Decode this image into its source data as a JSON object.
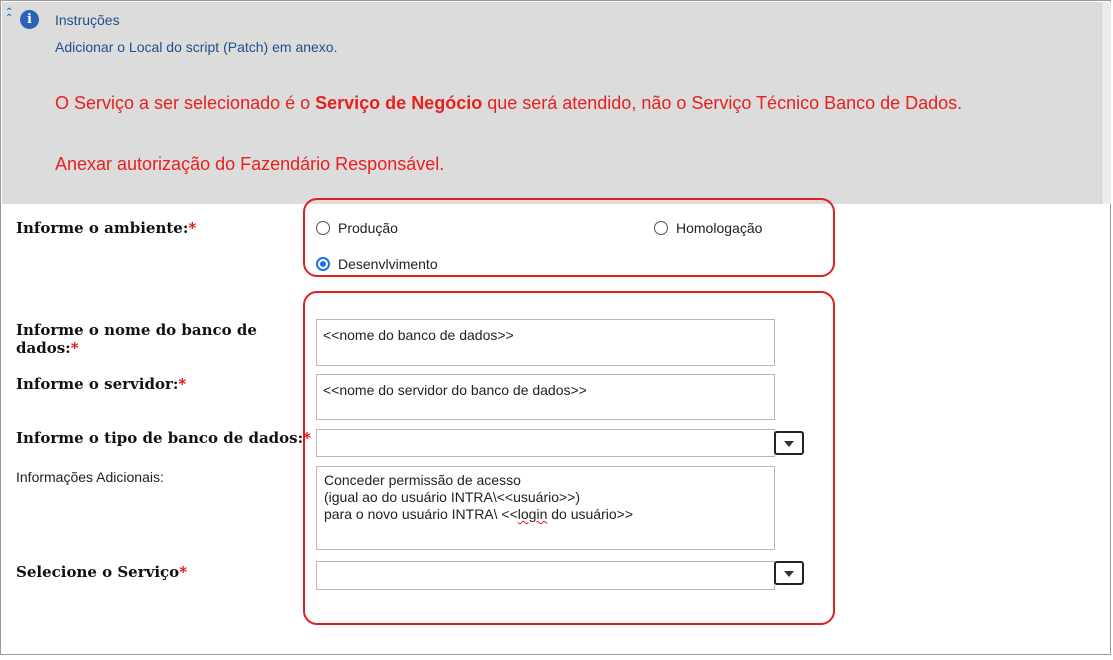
{
  "instructions": {
    "title": "Instruções",
    "line1": "Adicionar o Local do script (Patch) em anexo.",
    "red1_pre": "O Serviço a ser selecionado é o ",
    "red1_bold": "Serviço de Negócio",
    "red1_post": " que será atendido, não o Serviço Técnico Banco de Dados.",
    "red2": "Anexar autorização do Fazendário Responsável."
  },
  "form": {
    "ambiente_label": "Informe o ambiente:",
    "required_mark": "*",
    "options": {
      "producao": "Produção",
      "homologacao": "Homologação",
      "desenvolvimento": "Desenvlvimento"
    },
    "selected_option": "Desenvlvimento",
    "banco_label_1": "Informe o nome do banco de",
    "banco_label_2": "dados:",
    "banco_value": "<<nome do banco de dados>>",
    "servidor_label": "Informe o servidor:",
    "servidor_value": "<<nome do servidor do banco de dados>>",
    "tipo_label": "Informe o tipo de banco de dados:",
    "tipo_value": "",
    "info_label": "Informações Adicionais:",
    "info_line1": "Conceder permissão de acesso",
    "info_line2": "(igual ao do usuário INTRA\\<<usuário>>)",
    "info_line3_pre": "para o novo usuário INTRA\\ <<",
    "info_line3_spell": "login",
    "info_line3_post": " do usuário>>",
    "servico_label": "Selecione o Serviço",
    "servico_value": ""
  },
  "colors": {
    "panel_bg": "#dcdcdc",
    "instr_text": "#1f4e8a",
    "warning_red": "#e8201e",
    "highlight_red": "#e02020",
    "radio_blue": "#1a73e8"
  }
}
